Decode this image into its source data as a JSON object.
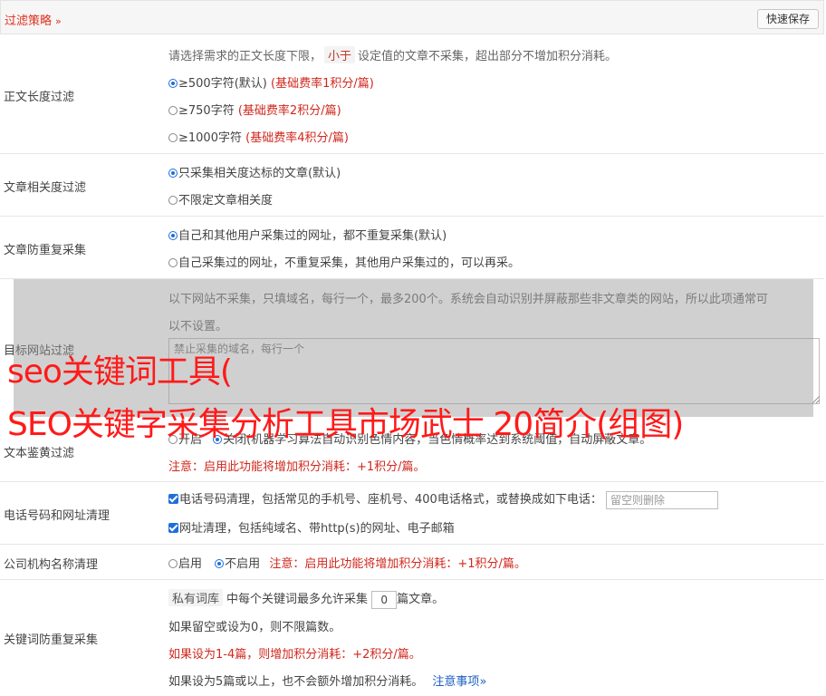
{
  "header": {
    "title": "过滤策略",
    "chevron": "»",
    "save_label": "快速保存"
  },
  "length_filter": {
    "label": "正文长度过滤",
    "desc_a": "请选择需求的正文长度下限，",
    "desc_tag": "小于",
    "desc_b": "设定值的文章不采集，超出部分不增加积分消耗。",
    "options": [
      {
        "text": "≥500字符(默认)",
        "note": "(基础费率1积分/篇)",
        "checked": true
      },
      {
        "text": "≥750字符",
        "note": "(基础费率2积分/篇)",
        "checked": false
      },
      {
        "text": "≥1000字符",
        "note": "(基础费率4积分/篇)",
        "checked": false
      }
    ]
  },
  "relevance": {
    "label": "文章相关度过滤",
    "options": [
      {
        "text": "只采集相关度达标的文章(默认)",
        "checked": true
      },
      {
        "text": "不限定文章相关度",
        "checked": false
      }
    ]
  },
  "dedupe": {
    "label": "文章防重复采集",
    "options": [
      {
        "text": "自己和其他用户采集过的网址，都不重复采集(默认)",
        "checked": true
      },
      {
        "text": "自己采集过的网址，不重复采集，其他用户采集过的，可以再采。",
        "checked": false
      }
    ]
  },
  "target_sites": {
    "label": "目标网站过滤",
    "desc_1": "以下网站不采集，只填域名，每行一个，最多200个。系统会自动识别并屏蔽那些非文章类的网站，所以此项通常可",
    "desc_2": "以不设置。",
    "placeholder": "禁止采集的域名，每行一个"
  },
  "porn_filter": {
    "label": "文本鉴黄过滤",
    "opt_on": "开启",
    "opt_rest": "关闭(机器学习算法自动识别色情内容，当色情概率达到系统阈值，自动屏蔽文章。",
    "note": "注意：启用此功能将增加积分消耗：+1积分/篇。"
  },
  "phone_clean": {
    "label": "电话号码和网址清理",
    "phone_text": "电话号码清理，包括常见的手机号、座机号、400电话格式，或替换成如下电话：",
    "phone_placeholder": "留空则删除",
    "url_text": "网址清理，包括纯域名、带http(s)的网址、电子邮箱"
  },
  "company_clean": {
    "label": "公司机构名称清理",
    "on": "启用",
    "off": "不启用",
    "note": "注意：启用此功能将增加积分消耗：+1积分/篇。"
  },
  "keyword_dedupe": {
    "label": "关键词防重复采集",
    "tag": "私有词库",
    "line1_a": "中每个关键词最多允许采集",
    "count": "0",
    "line1_b": "篇文章。",
    "line2": "如果留空或设为0，则不限篇数。",
    "line3": "如果设为1-4篇，则增加积分消耗：+2积分/篇。",
    "line4": "如果设为5篇或以上，也不会额外增加积分消耗。",
    "link": "注意事项"
  },
  "watermark": {
    "line1": "seo关键词工具(",
    "line2": "SEO关键字采集分析工具市场武士 20简介(组图)"
  },
  "colors": {
    "accent": "#e0301e",
    "blue": "#1e6fd9",
    "watermark": "#ff1a1a"
  }
}
